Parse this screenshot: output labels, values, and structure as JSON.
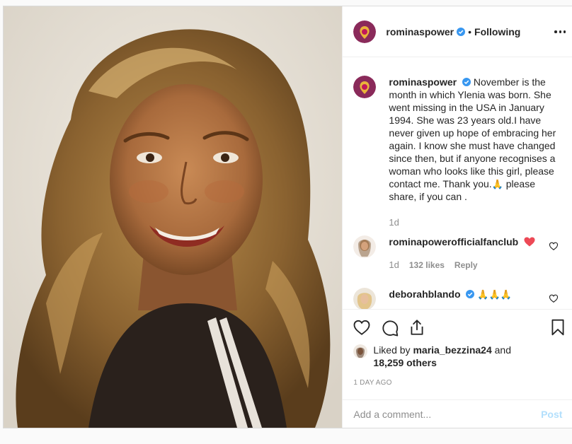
{
  "header": {
    "username": "rominaspower",
    "separator": "•",
    "follow_label": "Following"
  },
  "caption": {
    "username": "rominaspower",
    "text_part1": "November is the month in which Ylenia was born. She went missing in the USA in January 1994. She was 23 years old.I have never given up hope of embracing her again. I know she must have changed since then, but if anyone recognises a woman who looks like this girl, please contact me. Thank you.",
    "emoji": "🙏",
    "text_part2": " please share, if you can .",
    "time": "1d"
  },
  "comments": [
    {
      "username": "rominapowerofficialfanclub",
      "time": "1d",
      "likes": "132 likes",
      "reply": "Reply"
    },
    {
      "username": "deborahblando",
      "text": "🙏🙏🙏"
    }
  ],
  "likes": {
    "prefix": "Liked by ",
    "user": "maria_bezzina24",
    "and": " and",
    "others": "18,259 others"
  },
  "timestamp": "1 DAY AGO",
  "add_comment": {
    "placeholder": "Add a comment...",
    "post_label": "Post"
  },
  "colors": {
    "verified": "#3897f0",
    "heart": "#ed4956",
    "post_disabled": "#b2dffc"
  },
  "icons": {
    "like": "heart-outline-icon",
    "comment": "speech-bubble-icon",
    "share": "share-arrow-icon",
    "save": "bookmark-icon",
    "more": "more-options-icon"
  }
}
